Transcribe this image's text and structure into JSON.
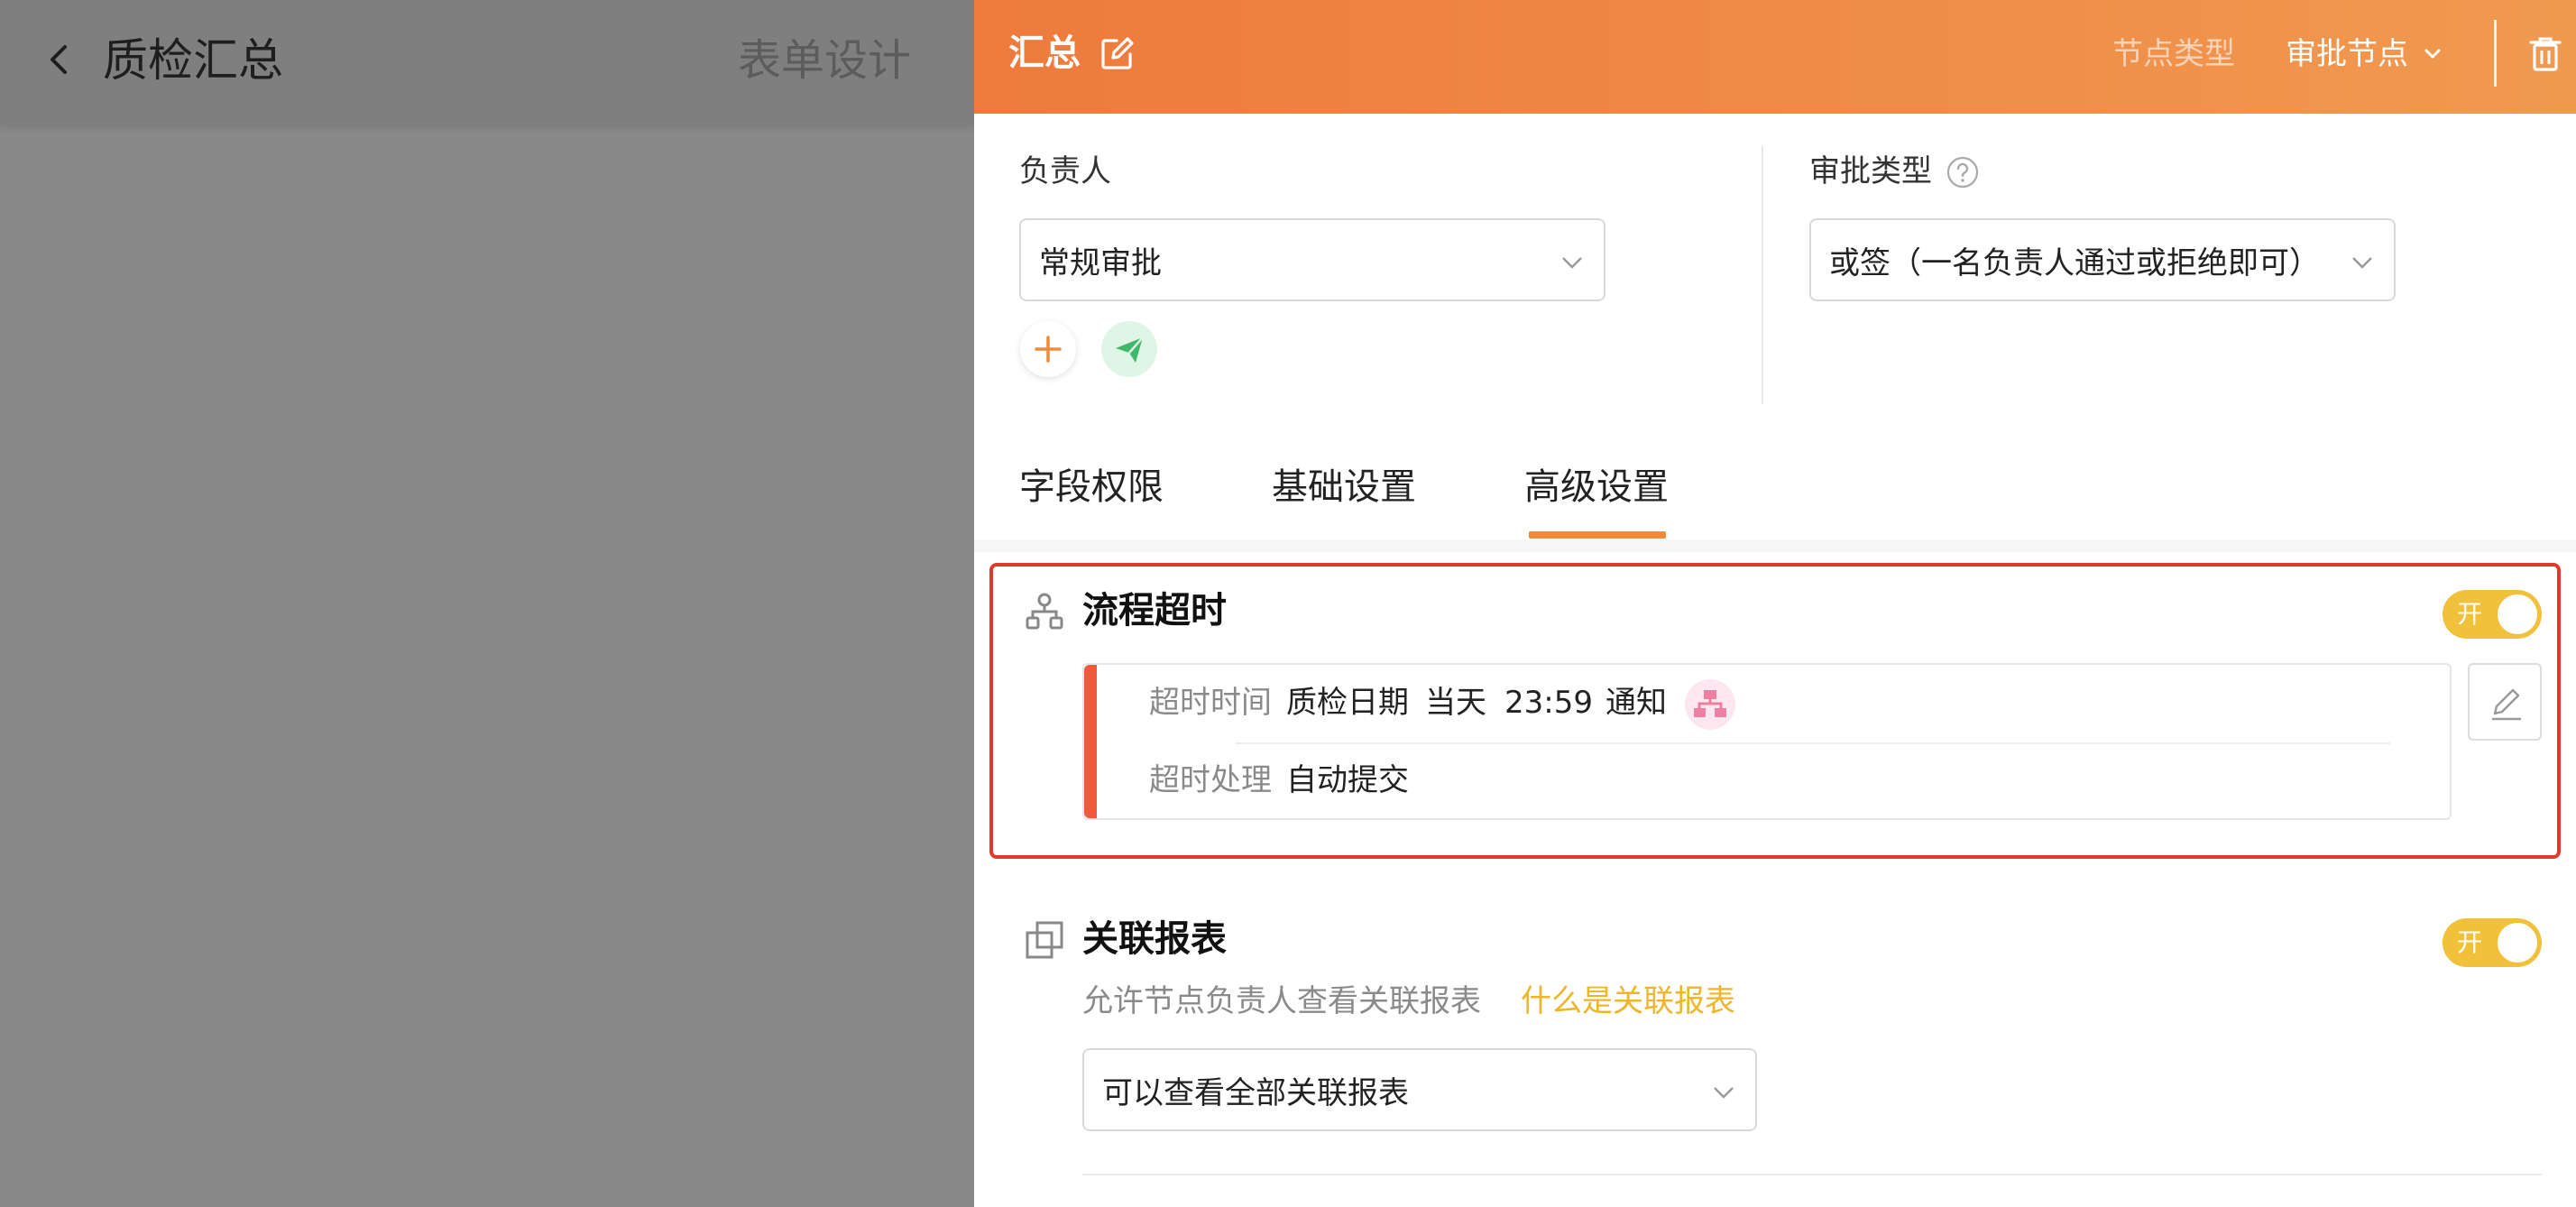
{
  "background": {
    "page_title": "质检汇总",
    "form_design_label": "表单设计"
  },
  "drawer": {
    "header": {
      "title": "汇总",
      "node_type_label": "节点类型",
      "node_type_value": "审批节点",
      "icons": [
        "edit-icon",
        "chevron-down-icon",
        "trash-icon"
      ],
      "gradient": [
        "#ee7a3d",
        "#f09a50"
      ]
    },
    "assignee": {
      "label": "负责人",
      "value": "常规审批"
    },
    "approval_type": {
      "label": "审批类型",
      "value": "或签（一名负责人通过或拒绝即可）"
    },
    "tabs": [
      {
        "label": "字段权限",
        "active": false
      },
      {
        "label": "基础设置",
        "active": false
      },
      {
        "label": "高级设置",
        "active": true
      }
    ],
    "timeout": {
      "title": "流程超时",
      "toggle_text": "开",
      "toggle_on": true,
      "time_label": "超时时间",
      "time_field": "质检日期",
      "time_day": "当天",
      "time_clock": "23:59",
      "notify_label": "通知",
      "handle_label": "超时处理",
      "handle_value": "自动提交"
    },
    "linked_reports": {
      "title": "关联报表",
      "toggle_text": "开",
      "toggle_on": true,
      "description": "允许节点负责人查看关联报表",
      "help_link": "什么是关联报表",
      "select_value": "可以查看全部关联报表"
    }
  },
  "colors": {
    "accent": "#f08a3c",
    "toggle_on": "#f2c13c",
    "highlight_border": "#e0392b",
    "link": "#f0b429"
  }
}
